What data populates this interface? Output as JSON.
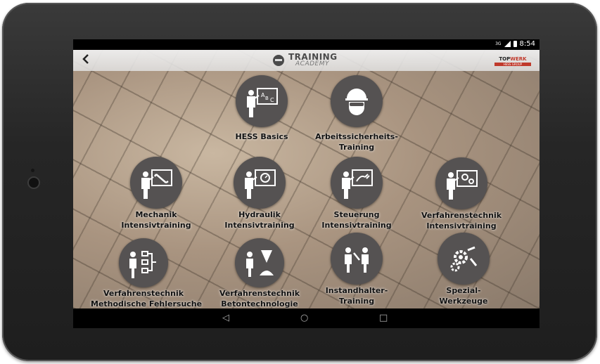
{
  "status": {
    "network": "3G",
    "time": "8:54"
  },
  "header": {
    "back_icon": "chevron-left-icon",
    "logo_line1": "TRAINING",
    "logo_line2": "ACADEMY",
    "brand_part1": "TOP",
    "brand_part2": "WERK",
    "brand_sub": "HESS GROUP"
  },
  "tiles": [
    {
      "line1": "HESS Basics",
      "line2": "",
      "icon": "teacher-abc-board-icon"
    },
    {
      "line1": "Arbeitssicherheits-",
      "line2": "Training",
      "icon": "worker-hardhat-icon"
    },
    {
      "line1": "Mechanik",
      "line2": "Intensivtraining",
      "icon": "teacher-wrench-board-icon"
    },
    {
      "line1": "Hydraulik",
      "line2": "Intensivtraining",
      "icon": "teacher-gauge-board-icon"
    },
    {
      "line1": "Steuerung",
      "line2": "Intensivtraining",
      "icon": "teacher-plug-board-icon"
    },
    {
      "line1": "Verfahrenstechnik",
      "line2": "Intensivtraining",
      "icon": "teacher-gears-board-icon"
    },
    {
      "line1": "Verfahrenstechnik",
      "line2": "Methodische Fehlersuche",
      "icon": "teacher-flowchart-icon"
    },
    {
      "line1": "Verfahrenstechnik",
      "line2": "Betontechnologie",
      "icon": "worker-concrete-icon"
    },
    {
      "line1": "Instandhalter-",
      "line2": "Training",
      "icon": "two-workers-tools-icon"
    },
    {
      "line1": "Spezial-",
      "line2": "Werkzeuge",
      "icon": "gears-wrench-icon"
    }
  ],
  "navbar": {
    "back": "◁",
    "home": "○",
    "recents": "□"
  },
  "colors": {
    "circle": "#555252",
    "accent": "#c0392b"
  }
}
